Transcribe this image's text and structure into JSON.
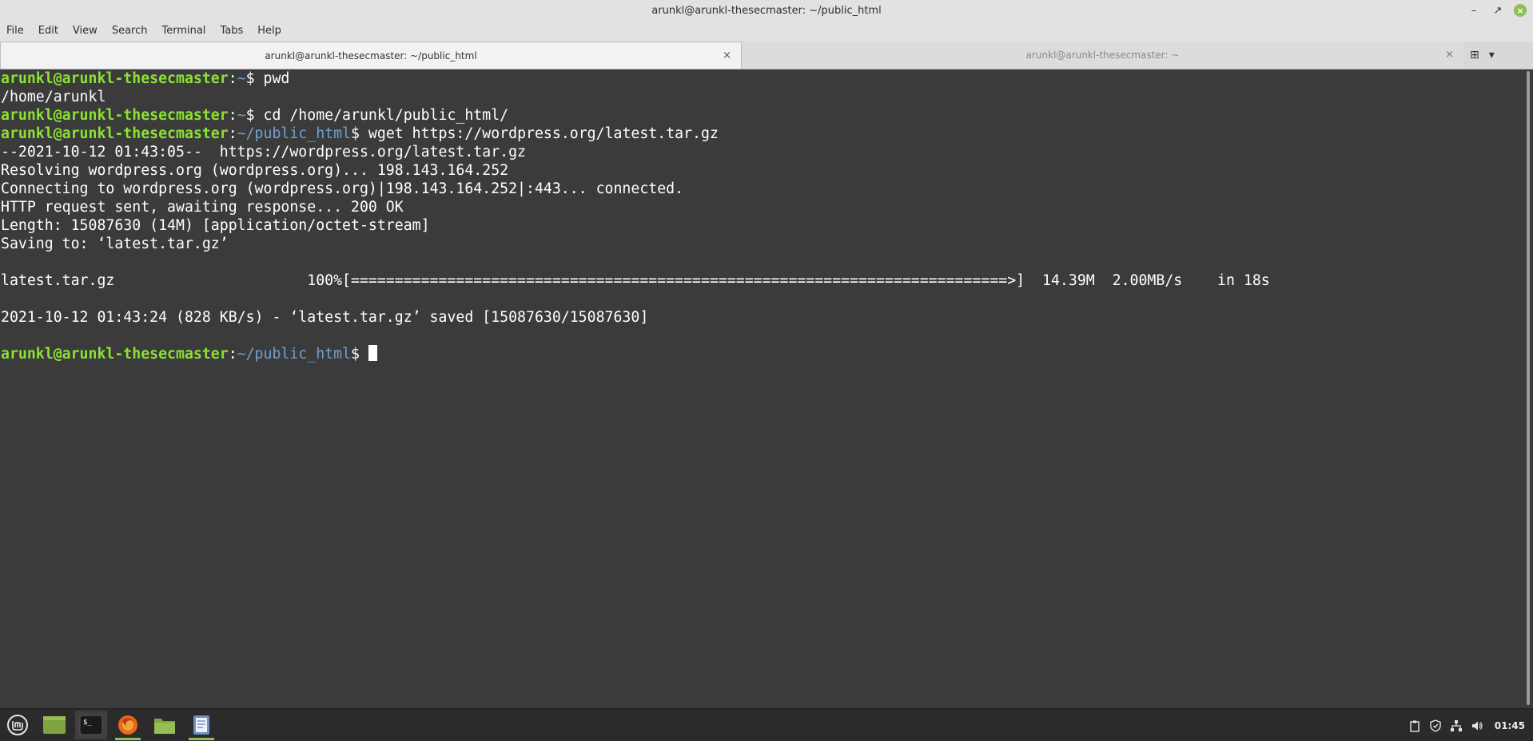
{
  "window": {
    "title": "arunkl@arunkl-thesecmaster: ~/public_html",
    "minimize_symbol": "–",
    "maximize_symbol": "↗",
    "close_symbol": "×"
  },
  "menu": [
    "File",
    "Edit",
    "View",
    "Search",
    "Terminal",
    "Tabs",
    "Help"
  ],
  "tabs": [
    {
      "label": "arunkl@arunkl-thesecmaster: ~/public_html",
      "close": "×"
    },
    {
      "label": "arunkl@arunkl-thesecmaster: ~",
      "close": "×"
    }
  ],
  "tab_actions": {
    "new_tab_symbol": "⊞",
    "menu_symbol": "▾"
  },
  "terminal": {
    "prompt_user": "arunkl@arunkl-thesecmaster",
    "lines": [
      {
        "type": "prompt",
        "path": "~",
        "command": " pwd"
      },
      {
        "type": "output",
        "text": "/home/arunkl"
      },
      {
        "type": "prompt",
        "path": "~",
        "command": " cd /home/arunkl/public_html/"
      },
      {
        "type": "prompt",
        "path": "~/public_html",
        "command": " wget https://wordpress.org/latest.tar.gz"
      },
      {
        "type": "output",
        "text": "--2021-10-12 01:43:05--  https://wordpress.org/latest.tar.gz"
      },
      {
        "type": "output",
        "text": "Resolving wordpress.org (wordpress.org)... 198.143.164.252"
      },
      {
        "type": "output",
        "text": "Connecting to wordpress.org (wordpress.org)|198.143.164.252|:443... connected."
      },
      {
        "type": "output",
        "text": "HTTP request sent, awaiting response... 200 OK"
      },
      {
        "type": "output",
        "text": "Length: 15087630 (14M) [application/octet-stream]"
      },
      {
        "type": "output",
        "text": "Saving to: ‘latest.tar.gz’"
      },
      {
        "type": "output",
        "text": ""
      },
      {
        "type": "output",
        "text": "latest.tar.gz                      100%[===========================================================================>]  14.39M  2.00MB/s    in 18s"
      },
      {
        "type": "output",
        "text": ""
      },
      {
        "type": "output",
        "text": "2021-10-12 01:43:24 (828 KB/s) - ‘latest.tar.gz’ saved [15087630/15087630]"
      },
      {
        "type": "output",
        "text": ""
      },
      {
        "type": "prompt",
        "path": "~/public_html",
        "command": " ",
        "cursor": true
      }
    ]
  },
  "taskbar": {
    "launchers": [
      {
        "name": "menu",
        "icon": "mint-menu-icon"
      },
      {
        "name": "show-desktop",
        "icon": "desktop-icon"
      },
      {
        "name": "terminal",
        "icon": "terminal-icon",
        "active": true
      },
      {
        "name": "firefox",
        "icon": "firefox-icon",
        "running": true
      },
      {
        "name": "files",
        "icon": "folder-icon"
      },
      {
        "name": "text-editor",
        "icon": "text-editor-icon",
        "running": true
      }
    ],
    "terminal_icon_text": "$_",
    "clock": "01:45"
  },
  "colors": {
    "prompt_user": "#8ae234",
    "prompt_path": "#729fcf",
    "terminal_bg": "#3b3b3b",
    "accent": "#8fbf5a"
  }
}
